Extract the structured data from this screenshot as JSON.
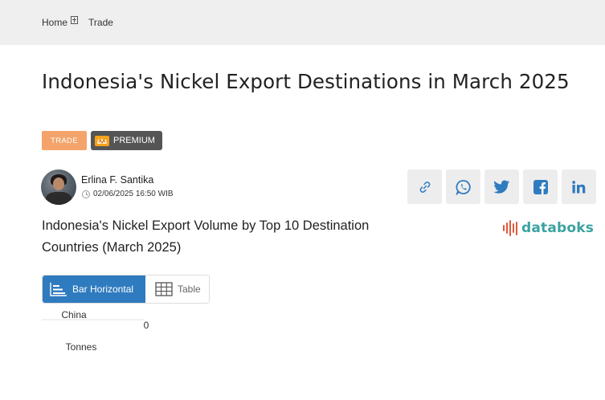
{
  "breadcrumb": {
    "home": "Home",
    "current": "Trade"
  },
  "article": {
    "title": "Indonesia's Nickel Export Destinations in March 2025",
    "category_badge": "TRADE",
    "premium_badge": "PREMIUM"
  },
  "author": {
    "name": "Erlina F. Santika",
    "date": "02/06/2025 16:50 WIB"
  },
  "share": {
    "icons": [
      "link-icon",
      "whatsapp-icon",
      "twitter-icon",
      "facebook-icon",
      "linkedin-icon"
    ]
  },
  "chart_section": {
    "title": "Indonesia's Nickel Export Volume by Top 10 Destination Countries (March 2025)",
    "logo_text": "databoks",
    "tabs": [
      {
        "label": "Bar Horizontal",
        "active": true
      },
      {
        "label": "Table",
        "active": false
      }
    ]
  },
  "colors": {
    "topbar": "#efefef",
    "accent_blue": "#2f7bbf",
    "trade_badge": "#f4a46a",
    "premium_badge": "#555555",
    "databoks_teal": "#3aa3a1",
    "databoks_red": "#e15a3c"
  },
  "chart_data": {
    "type": "bar",
    "orientation": "horizontal",
    "categories": [
      "China"
    ],
    "values": [
      0
    ],
    "value_labels": [
      "0"
    ],
    "xlabel": "Tonnes",
    "grid": false
  }
}
